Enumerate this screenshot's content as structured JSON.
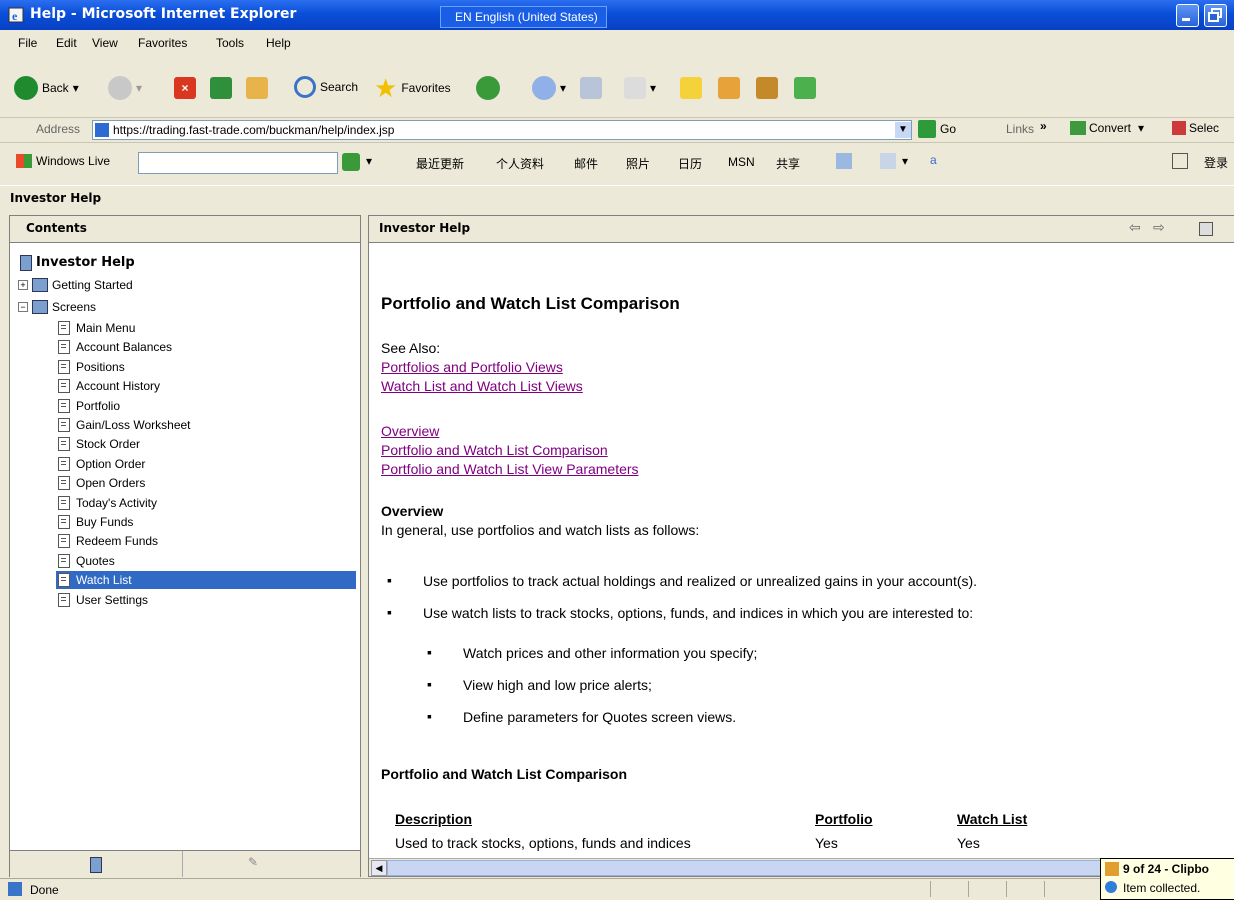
{
  "window": {
    "title": "Help - Microsoft Internet Explorer",
    "language_bar": "EN English (United States)"
  },
  "menu": [
    "File",
    "Edit",
    "View",
    "Favorites",
    "Tools",
    "Help"
  ],
  "toolbar": {
    "back_label": "Back",
    "search_label": "Search",
    "favorites_label": "Favorites"
  },
  "address": {
    "label": "Address",
    "url": "https://trading.fast-trade.com/buckman/help/index.jsp",
    "go_label": "Go",
    "links_label": "Links",
    "convert_label": "Convert",
    "select_label": "Selec"
  },
  "live_toolbar": {
    "brand": "Windows Live",
    "search_value": "",
    "links": [
      "最近更新",
      "个人资料",
      "邮件",
      "照片",
      "日历",
      "MSN",
      "共享"
    ],
    "signin": "登录"
  },
  "help_title": "Investor Help",
  "contents": {
    "header": "Contents",
    "root": "Investor Help",
    "getting_started": "Getting Started",
    "screens": "Screens",
    "items": [
      "Main Menu",
      "Account Balances",
      "Positions",
      "Account History",
      "Portfolio",
      "Gain/Loss Worksheet",
      "Stock Order",
      "Option Order",
      "Open Orders",
      "Today's Activity",
      "Buy Funds",
      "Redeem Funds",
      "Quotes",
      "Watch List",
      "User Settings"
    ],
    "selected_index": 13
  },
  "doc": {
    "header": "Investor Help",
    "title": "Portfolio and Watch List Comparison",
    "see_also_label": "See Also:",
    "see_also_links": [
      "Portfolios and Portfolio Views",
      "Watch List and Watch List Views"
    ],
    "section_links": [
      "Overview",
      "Portfolio and Watch List Comparison",
      "Portfolio and Watch List View Parameters"
    ],
    "overview_heading": "Overview",
    "overview_text": "In general, use portfolios and watch lists as follows:",
    "bullets": [
      "Use portfolios to track actual holdings and realized or unrealized gains in your account(s).",
      "Use watch lists to track stocks, options, funds, and indices in which you are interested to:"
    ],
    "sub_bullets": [
      "Watch prices and other information you specify;",
      "View high and low price alerts;",
      "Define parameters for Quotes screen views."
    ],
    "comparison_heading": "Portfolio and Watch List Comparison",
    "table": {
      "headers": [
        "Description",
        "Portfolio",
        "Watch List"
      ],
      "rows": [
        [
          "Used to track stocks, options, funds and indices",
          "Yes",
          "Yes"
        ]
      ]
    }
  },
  "status": {
    "text": "Done",
    "tray_count": "9 of 24 - Clipbo",
    "tray_msg": "Item collected."
  },
  "colors": {
    "titlebar": "#0a4fd8",
    "link": "#800080",
    "selected": "#316ac5"
  }
}
